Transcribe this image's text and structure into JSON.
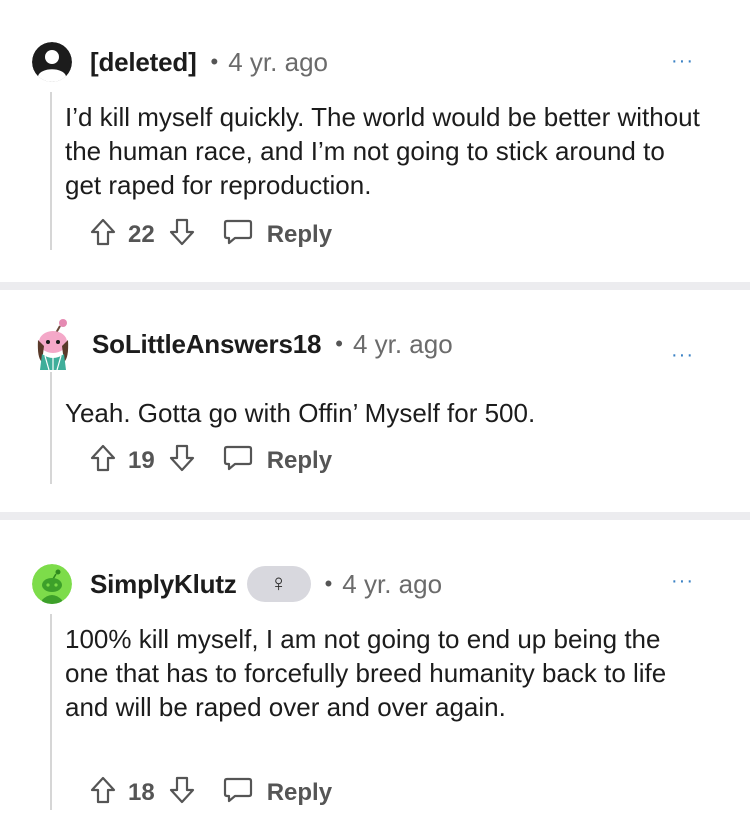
{
  "comments": [
    {
      "username": "[deleted]",
      "separator": "•",
      "time": "4 yr. ago",
      "more": "···",
      "body": "I’d kill myself quickly. The world would be better without the human race, and I’m not going to stick around to get raped for reproduction.",
      "votes": "22",
      "reply_label": "Reply",
      "avatar_icon": "deleted-user-avatar-icon"
    },
    {
      "username": "SoLittleAnswers18",
      "separator": "•",
      "time": "4 yr. ago",
      "more": "···",
      "body": "Yeah. Gotta go with Offin’ Myself for 500.",
      "votes": "19",
      "reply_label": "Reply",
      "avatar_icon": "snoo-avatar-pink-icon"
    },
    {
      "username": "SimplyKlutz",
      "flair": "♀",
      "separator": "•",
      "time": "4 yr. ago",
      "more": "···",
      "body": "100% kill myself, I am not going to end up being the one that has to forcefully breed humanity back to life and will be raped over and over again.",
      "votes": "18",
      "reply_label": "Reply",
      "avatar_icon": "snoo-avatar-green-icon"
    }
  ],
  "colors": {
    "separator": "#ececef",
    "thread_line": "#d6d6d6",
    "more_menu": "#3b82c4",
    "green_avatar": "#7ddc4a"
  }
}
